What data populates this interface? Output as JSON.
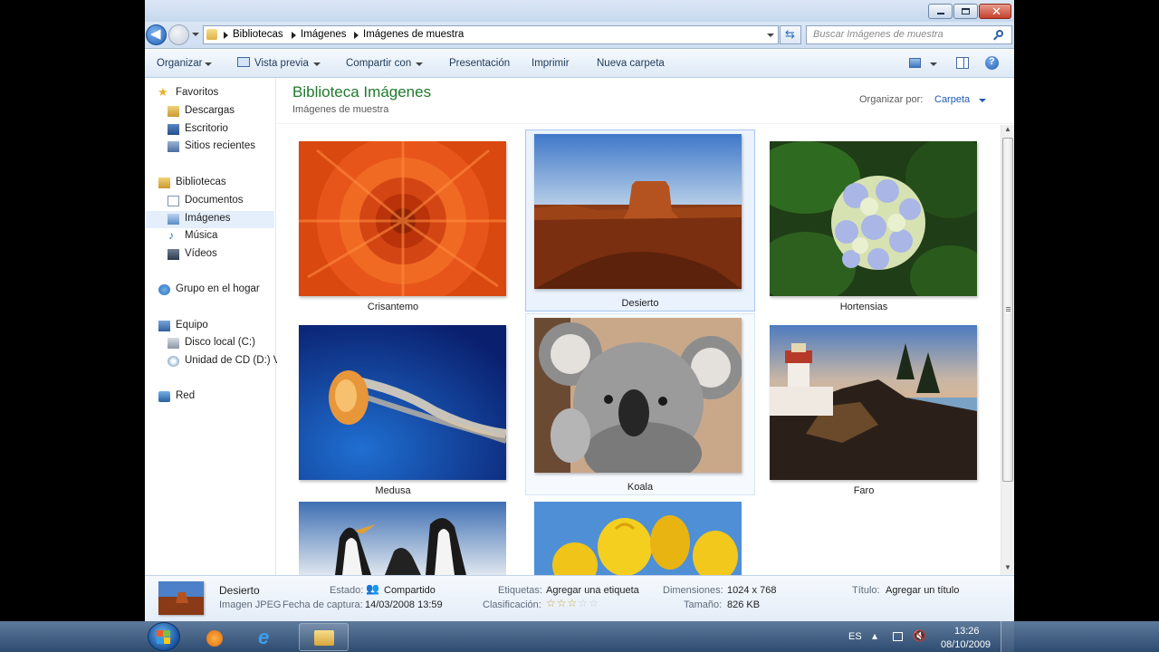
{
  "window": {
    "controls": {
      "minimize": "minimize-icon",
      "maximize": "maximize-icon",
      "close": "close-icon"
    }
  },
  "address_bar": {
    "breadcrumbs": [
      "Bibliotecas",
      "Imágenes",
      "Imágenes de muestra"
    ],
    "search_placeholder": "Buscar Imágenes de muestra"
  },
  "command_bar": {
    "organize": "Organizar",
    "preview": "Vista previa",
    "share": "Compartir con",
    "slideshow": "Presentación",
    "print": "Imprimir",
    "new_folder": "Nueva carpeta"
  },
  "sidebar": {
    "favorites": {
      "label": "Favoritos",
      "items": [
        "Descargas",
        "Escritorio",
        "Sitios recientes"
      ]
    },
    "libraries": {
      "label": "Bibliotecas",
      "items": [
        "Documentos",
        "Imágenes",
        "Música",
        "Vídeos"
      ]
    },
    "homegroup": "Grupo en el hogar",
    "computer": {
      "label": "Equipo",
      "items": [
        "Disco local (C:)",
        "Unidad de CD (D:) V"
      ]
    },
    "network": "Red",
    "selected": "Imágenes"
  },
  "main": {
    "title": "Biblioteca Imágenes",
    "subtitle": "Imágenes de muestra",
    "arrange_label": "Organizar por:",
    "arrange_value": "Carpeta",
    "items": [
      {
        "name": "Crisantemo",
        "selected": false
      },
      {
        "name": "Desierto",
        "selected": true
      },
      {
        "name": "Hortensias",
        "selected": false
      },
      {
        "name": "Medusa",
        "selected": false
      },
      {
        "name": "Koala",
        "selected": false
      },
      {
        "name": "Faro",
        "selected": false
      },
      {
        "name": "",
        "selected": false
      },
      {
        "name": "",
        "selected": false
      }
    ]
  },
  "details": {
    "file_name": "Desierto",
    "file_type": "Imagen JPEG",
    "state_label": "Estado:",
    "state_value": "Compartido",
    "date_label": "Fecha de captura:",
    "date_value": "14/03/2008 13:59",
    "tags_label": "Etiquetas:",
    "tags_value": "Agregar una etiqueta",
    "rating_label": "Clasificación:",
    "rating": 3,
    "rating_max": 5,
    "dimensions_label": "Dimensiones:",
    "dimensions_value": "1024 x 768",
    "size_label": "Tamaño:",
    "size_value": "826 KB",
    "title_label": "Título:",
    "title_value": "Agregar un título"
  },
  "taskbar": {
    "language": "ES",
    "time": "13:26",
    "date": "08/10/2009"
  },
  "colors": {
    "library_title": "#1f7a2d",
    "link": "#1e5bb8",
    "selection": "#eaf2fd",
    "star_filled": "#c8a630"
  }
}
